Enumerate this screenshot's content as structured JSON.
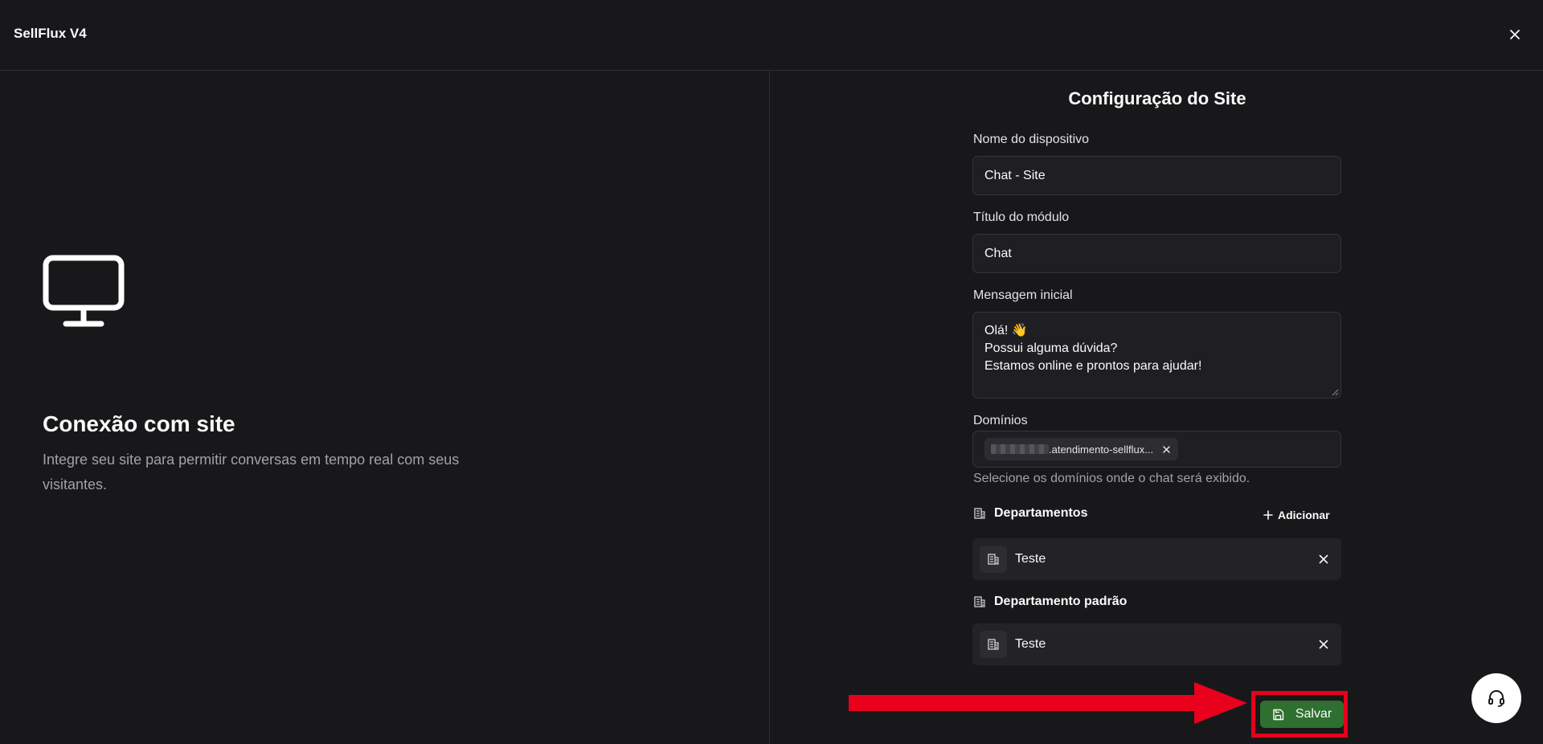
{
  "app": {
    "title": "SellFlux V4"
  },
  "icons": {
    "close": "close-icon",
    "monitor": "monitor-icon",
    "building": "building-icon",
    "plus": "plus-icon",
    "save": "save-icon",
    "headset": "headset-icon"
  },
  "left": {
    "title": "Conexão com site",
    "description": "Integre seu site para permitir conversas em tempo real com seus visitantes."
  },
  "form": {
    "title": "Configuração do Site",
    "device_name": {
      "label": "Nome do dispositivo",
      "value": "Chat - Site"
    },
    "module_title": {
      "label": "Título do módulo",
      "value": "Chat"
    },
    "initial_message": {
      "label": "Mensagem inicial",
      "lines": [
        "Olá! 👋",
        "Possui alguma dúvida?",
        "Estamos online e prontos para ajudar!"
      ]
    },
    "domains": {
      "label": "Domínios",
      "chips": [
        {
          "label": ".atendimento-sellflux..."
        }
      ],
      "hint": "Selecione os domínios onde o chat será exibido."
    },
    "departments": {
      "title": "Departamentos",
      "add_label": "Adicionar",
      "items": [
        {
          "name": "Teste"
        }
      ]
    },
    "default_department": {
      "title": "Departamento padrão",
      "items": [
        {
          "name": "Teste"
        }
      ]
    },
    "save_label": "Salvar"
  },
  "colors": {
    "background": "#18181b",
    "accent_green": "#2f6f2f",
    "highlight_red": "#e8001c"
  }
}
